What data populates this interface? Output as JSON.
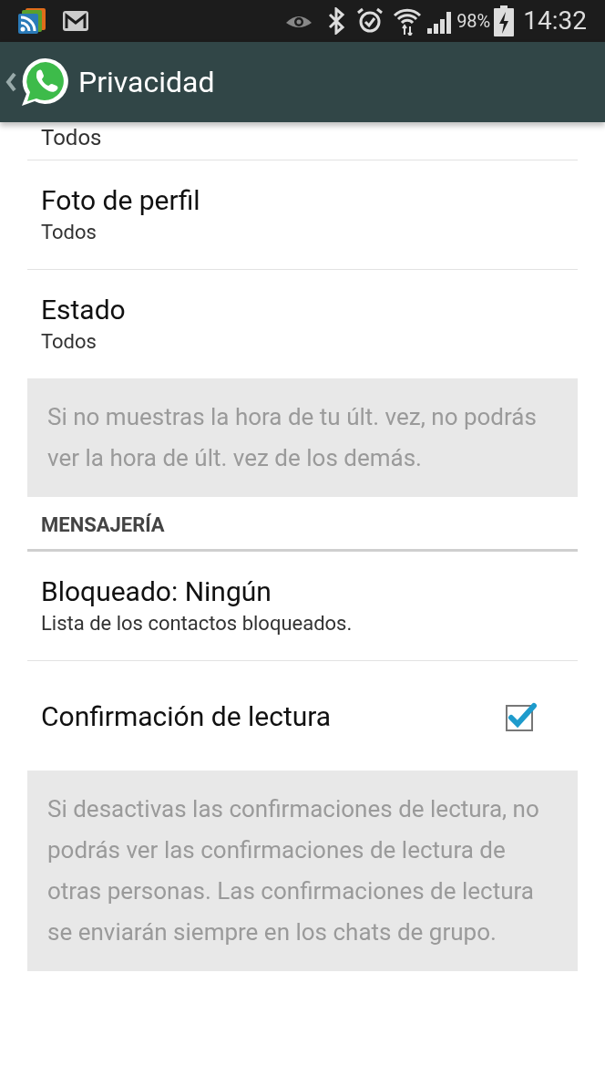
{
  "status_bar": {
    "battery": "98%",
    "time": "14:32"
  },
  "app_bar": {
    "title": "Privacidad"
  },
  "items": [
    {
      "kind": "cutoff",
      "summary": "Todos"
    },
    {
      "kind": "setting",
      "title": "Foto de perfil",
      "summary": "Todos"
    },
    {
      "kind": "setting",
      "title": "Estado",
      "summary": "Todos"
    },
    {
      "kind": "note",
      "text": "Si no muestras la hora de tu últ. vez, no podrás ver la hora de últ. vez de los demás."
    },
    {
      "kind": "header",
      "text": "MENSAJERÍA"
    },
    {
      "kind": "setting",
      "title": "Bloqueado: Ningún",
      "summary": "Lista de los contactos bloqueados."
    },
    {
      "kind": "checkbox",
      "title": "Confirmación de lectura",
      "checked": true
    },
    {
      "kind": "note",
      "text": "Si desactivas las confirmaciones de lectura, no podrás ver las confirmaciones de lectura de otras personas. Las confirmaciones de lectura se enviarán siempre en los chats de grupo."
    }
  ]
}
